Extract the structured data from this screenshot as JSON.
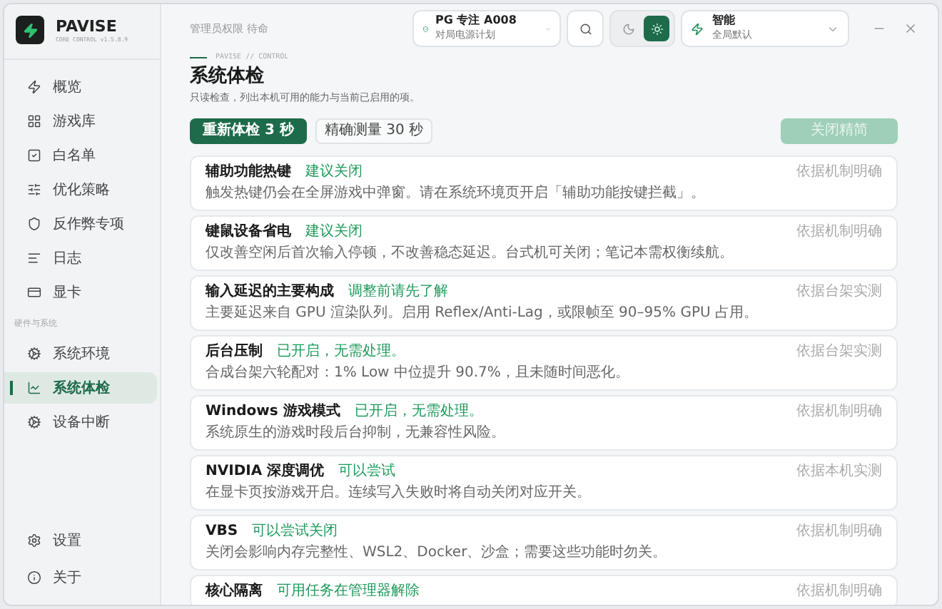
{
  "app": {
    "name": "PAVISE",
    "version": "CORE CONTROL v1.5.8.9"
  },
  "sidebar": {
    "items": [
      {
        "label": "概览",
        "selected": false
      },
      {
        "label": "游戏库",
        "selected": false
      },
      {
        "label": "白名单",
        "selected": false
      },
      {
        "label": "优化策略",
        "selected": false
      },
      {
        "label": "反作弊专项",
        "selected": false
      },
      {
        "label": "日志",
        "selected": false
      },
      {
        "label": "显卡",
        "selected": false
      }
    ],
    "section": {
      "label": "硬件与系统",
      "items": [
        {
          "label": "系统环境",
          "selected": false
        },
        {
          "label": "系统体检",
          "selected": true
        },
        {
          "label": "设备中断",
          "selected": false
        }
      ]
    },
    "footer_items": [
      {
        "label": "设置",
        "selected": false
      },
      {
        "label": "关于",
        "selected": false
      }
    ]
  },
  "topbar": {
    "status": "管理员权限 待命",
    "power_plan": {
      "title": "PG 专注 A008",
      "subtitle": "对局电源计划"
    },
    "theme_toggle": [
      {
        "selected": false
      },
      {
        "selected": true
      }
    ],
    "mode": {
      "title": "智能",
      "subtitle": "全局默认"
    }
  },
  "page": {
    "breadcrumb": "PAVISE // CONTROL",
    "title": "系统体检",
    "subtitle": "只读检查，列出本机可用的能力与当前已启用的项。",
    "actions": [
      {
        "label": "重新体检 3 秒",
        "selected": true
      },
      {
        "label": "精确测量 30 秒",
        "selected": false
      }
    ],
    "apply_button": {
      "label": "关闭精简",
      "disabled": true
    }
  },
  "checks": [
    {
      "title": "辅助功能热键",
      "tag": "建议关闭",
      "description": "触发热键仍会在全屏游戏中弹窗。请在系统环境页开启「辅助功能按键拦截」。",
      "source": "依据机制明确"
    },
    {
      "title": "键鼠设备省电",
      "tag": "建议关闭",
      "description": "仅改善空闲后首次输入停顿，不改善稳态延迟。台式机可关闭；笔记本需权衡续航。",
      "source": "依据机制明确"
    },
    {
      "title": "输入延迟的主要构成",
      "tag": "调整前请先了解",
      "description": "主要延迟来自 GPU 渲染队列。启用 Reflex/Anti-Lag，或限帧至 90–95% GPU 占用。",
      "source": "依据台架实测"
    },
    {
      "title": "后台压制",
      "tag": "已开启，无需处理。",
      "description": "合成台架六轮配对：1% Low 中位提升 90.7%，且未随时间恶化。",
      "source": "依据台架实测"
    },
    {
      "title": "Windows 游戏模式",
      "tag": "已开启，无需处理。",
      "description": "系统原生的游戏时段后台抑制，无兼容性风险。",
      "source": "依据机制明确"
    },
    {
      "title": "NVIDIA 深度调优",
      "tag": "可以尝试",
      "description": "在显卡页按游戏开启。连续写入失败时将自动关闭对应开关。",
      "source": "依据本机实测"
    },
    {
      "title": "VBS",
      "tag": "可以尝试关闭",
      "description": "关闭会影响内存完整性、WSL2、Docker、沙盒；需要这些功能时勿关。",
      "source": "依据机制明确"
    },
    {
      "title": "核心隔离",
      "tag": "可用任务在管理器解除",
      "source": "依据机制明确"
    }
  ]
}
